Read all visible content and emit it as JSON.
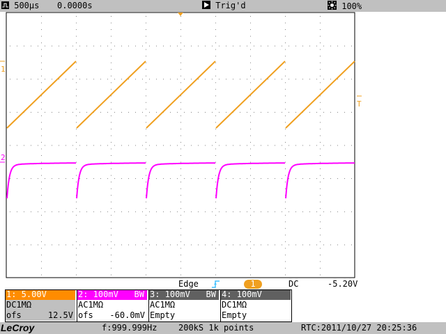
{
  "top_bar": {
    "timebase": "500µs",
    "delay": "0.0000s",
    "trigger_state": "Trig'd",
    "intensity": "100%"
  },
  "markers": {
    "ch1": "1",
    "ch2": "2",
    "trigger_level": "T"
  },
  "trigger": {
    "type": "Edge",
    "source": "1",
    "coupling": "DC",
    "level": "-5.20V"
  },
  "channels": [
    {
      "header": "1: 5.00V",
      "bw": "",
      "coupling": "DC1MΩ",
      "offset_label": "ofs",
      "offset_value": "12.5V",
      "header_bg": "#ff8c00",
      "header_fg": "#ffffff"
    },
    {
      "header": "2: 100mV",
      "bw": "BW",
      "coupling": "AC1MΩ",
      "offset_label": "ofs",
      "offset_value": "-60.0mV",
      "header_bg": "#ff00ff",
      "header_fg": "#ffffff"
    },
    {
      "header": "3: 100mV",
      "bw": "BW",
      "coupling": "AC1MΩ",
      "offset_label": "Empty",
      "offset_value": "",
      "header_bg": "#606060",
      "header_fg": "#ffffff"
    },
    {
      "header": "4: 100mV",
      "bw": "",
      "coupling": "DC1MΩ",
      "offset_label": "Empty",
      "offset_value": "",
      "header_bg": "#606060",
      "header_fg": "#ffffff"
    }
  ],
  "status": {
    "brand": "LeCroy",
    "frequency": "f:999.999Hz",
    "acquisition": "200kS 1k points",
    "rtc": "RTC:2011/10/27 20:25:36"
  },
  "colors": {
    "ch1": "#f0a020",
    "ch2": "#ff00ff",
    "grid_dot": "#808080",
    "trigger_marker": "#40c0ff"
  }
}
